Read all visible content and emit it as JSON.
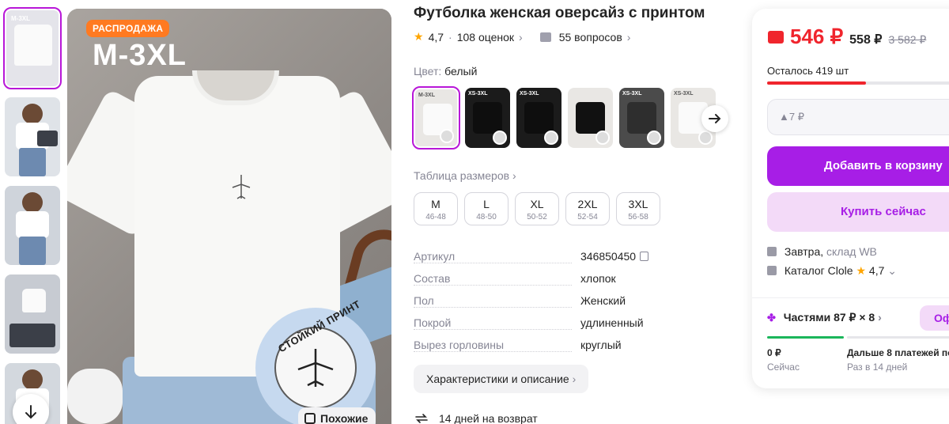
{
  "gallery": {
    "thumbs": [
      {
        "label": "M-3XL"
      },
      {
        "label": ""
      },
      {
        "label": ""
      },
      {
        "label": ""
      },
      {
        "label": ""
      }
    ],
    "main": {
      "badge": "РАСПРОДАЖА",
      "size_overlay": "M-3XL",
      "stamp_text": "СТОЙКИЙ ПРИНТ",
      "similar_button": "Похожие"
    },
    "scroll_down_icon": "arrow-down-icon"
  },
  "product": {
    "title": "Футболка женская оверсайз с принтом",
    "rating": "4,7",
    "reviews": "108 оценок",
    "questions": "55 вопросов",
    "color_label": "Цвет:",
    "color_value": "белый",
    "variants": [
      {
        "label": "M-3XL",
        "tone": "white"
      },
      {
        "label": "XS-3XL",
        "tone": "black"
      },
      {
        "label": "XS-3XL",
        "tone": "black"
      },
      {
        "label": "",
        "tone": "black"
      },
      {
        "label": "XS-3XL",
        "tone": "dark"
      },
      {
        "label": "XS-3XL",
        "tone": "white"
      }
    ],
    "size_table_link": "Таблица размеров",
    "sizes": [
      {
        "size": "M",
        "range": "46-48"
      },
      {
        "size": "L",
        "range": "48-50"
      },
      {
        "size": "XL",
        "range": "50-52"
      },
      {
        "size": "2XL",
        "range": "52-54"
      },
      {
        "size": "3XL",
        "range": "56-58"
      }
    ],
    "specs": [
      {
        "key": "Артикул",
        "value": "346850450"
      },
      {
        "key": "Состав",
        "value": "хлопок"
      },
      {
        "key": "Пол",
        "value": "Женский"
      },
      {
        "key": "Покрой",
        "value": "удлиненный"
      },
      {
        "key": "Вырез горловины",
        "value": "круглый"
      }
    ],
    "characteristics_button": "Характеристики и описание",
    "return_policy": "14 дней на возврат"
  },
  "buy_card": {
    "price": "546 ₽",
    "price_wallet_alt": "558 ₽",
    "price_old": "3 582 ₽",
    "stock_text": "Осталось 419 шт",
    "stock_fraction": 0.48,
    "promo": "▲7 ₽",
    "add_to_cart": "Добавить в корзину",
    "buy_now": "Купить сейчас",
    "delivery_when": "Завтра,",
    "delivery_where": "склад WB",
    "seller_name": "Каталог Clole",
    "seller_rating": "4,7",
    "installments": "Частями 87 ₽ × 8",
    "installments_btn": "Оф",
    "pay_now_amount": "0 ₽",
    "pay_now_label": "Сейчас",
    "pay_later_amount": "Дальше 8 платежей по",
    "pay_later_label": "Раз в 14 дней"
  },
  "colors": {
    "accent": "#a71ee6",
    "price_red": "#f0252d",
    "sale_orange": "#ff7a21",
    "muted": "#868695"
  }
}
